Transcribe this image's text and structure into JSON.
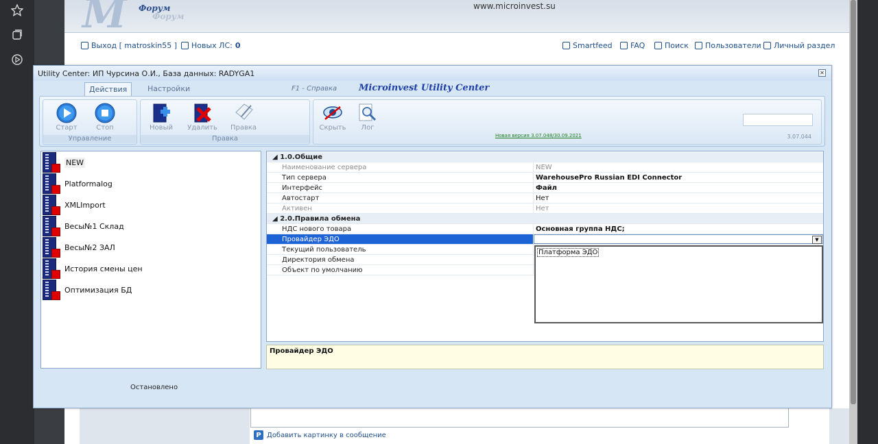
{
  "forum": {
    "url": "www.microinvest.su",
    "logo_text": "Форум",
    "logo_shadow": "Форум",
    "nav": {
      "logout": "Выход [ matroskin55 ]",
      "new_pm_label": "Новых ЛС:",
      "new_pm_count": "0",
      "smartfeed": "Smartfeed",
      "faq": "FAQ",
      "search": "Поиск",
      "users": "Пользователи",
      "personal": "Личный раздел"
    },
    "add_image_link": "Добавить картинку в сообщение"
  },
  "window": {
    "title": "Utility Center: ИП Чурсина О.И., База данных: RADYGA1",
    "tabs": [
      "Действия",
      "Настройки"
    ],
    "help": "F1 - Справка",
    "brand": "Microinvest Utility Center",
    "groups": {
      "control": "Управление",
      "edit": "Правка"
    },
    "buttons": {
      "start": "Старт",
      "stop": "Стоп",
      "new": "Новый",
      "delete": "Удалить",
      "edit": "Правка",
      "hide": "Скрыть",
      "log": "Лог"
    },
    "new_version": "Новая версия 3.07.048/30.09.2021",
    "version": "3.07.044",
    "status": "Остановлено"
  },
  "connectors": [
    {
      "label": "NEW"
    },
    {
      "label": "Platformalog"
    },
    {
      "label": "XMLImport"
    },
    {
      "label": "Весы№1 Склад"
    },
    {
      "label": "Весы№2 ЗАЛ"
    },
    {
      "label": "История смены цен"
    },
    {
      "label": "Оптимизация БД"
    }
  ],
  "properties": {
    "cat1": "1.0.Общие",
    "cat2": "2.0.Правила обмена",
    "rows": [
      {
        "name": "Наименование сервера",
        "value": "NEW"
      },
      {
        "name": "Тип сервера",
        "value": "WarehousePro Russian EDI Connector"
      },
      {
        "name": "Интерфейс",
        "value": "Файл"
      },
      {
        "name": "Автостарт",
        "value": "Нет"
      },
      {
        "name": "Активен",
        "value": "Нет"
      },
      {
        "name": "НДС нового товара",
        "value": "Основная группа НДС;"
      },
      {
        "name": "Провайдер ЭДО",
        "value": ""
      },
      {
        "name": "Текущий пользователь",
        "value": ""
      },
      {
        "name": "Директория обмена",
        "value": ""
      },
      {
        "name": "Объект по умолчанию",
        "value": ""
      }
    ],
    "dropdown_option": "Платформа ЭДО"
  },
  "description": {
    "title": "Провайдер ЭДО"
  },
  "colors": {
    "selection": "#1e63d6",
    "brand": "#1e3fa8",
    "delete_red": "#e10000"
  }
}
